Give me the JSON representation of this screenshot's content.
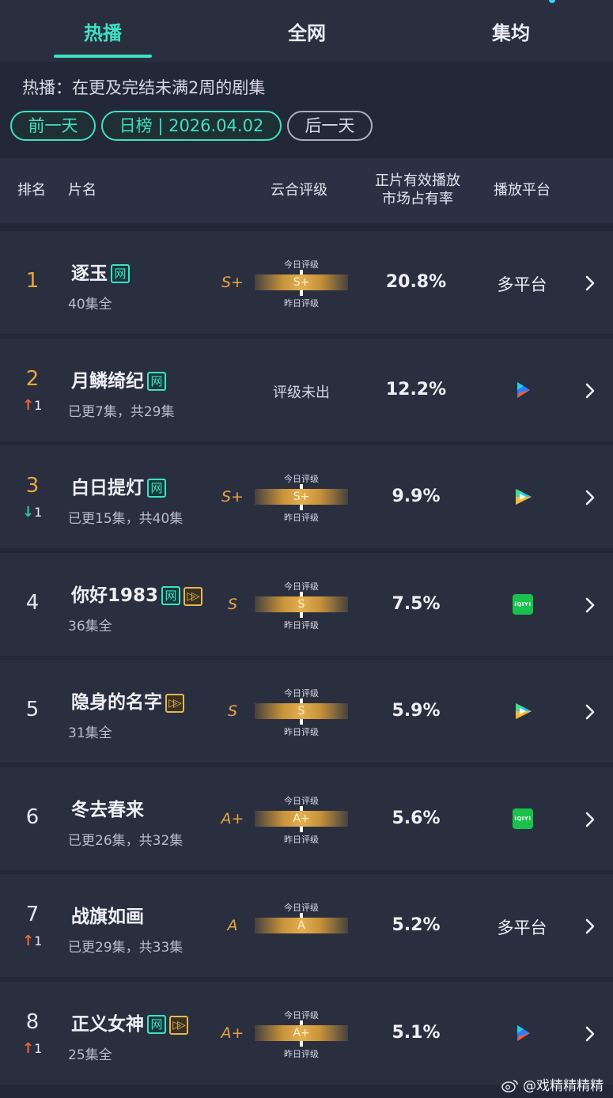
{
  "tabs": [
    {
      "label": "热播",
      "active": true
    },
    {
      "label": "全网",
      "active": false
    },
    {
      "label": "集均",
      "active": false
    }
  ],
  "subtitle": "热播：在更及完结未满2周的剧集",
  "nav": {
    "prev": "前一天",
    "current": "日榜 | 2026.04.02",
    "next": "后一天"
  },
  "table_header": {
    "rank": "排名",
    "name": "片名",
    "rating": "云合评级",
    "share_line1": "正片有效播放",
    "share_line2": "市场占有率",
    "platform": "播放平台"
  },
  "gauge_labels": {
    "today": "今日评级",
    "yesterday": "昨日评级"
  },
  "rows": [
    {
      "rank": "1",
      "change_dir": "",
      "change": "",
      "title": "逐玉",
      "badges": [
        "网"
      ],
      "episodes": "40集全",
      "grade": "S+",
      "gauge": "S+",
      "show_yesterday": true,
      "pending": "",
      "share": "20.8%",
      "platform_text": "多平台",
      "platform_icon": ""
    },
    {
      "rank": "2",
      "change_dir": "up",
      "change": "1",
      "title": "月鳞绮纪",
      "badges": [
        "网"
      ],
      "episodes": "已更7集，共29集",
      "grade": "",
      "gauge": "",
      "show_yesterday": false,
      "pending": "评级未出",
      "share": "12.2%",
      "platform_text": "",
      "platform_icon": "youku-icon"
    },
    {
      "rank": "3",
      "change_dir": "down",
      "change": "1",
      "title": "白日提灯",
      "badges": [
        "网"
      ],
      "episodes": "已更15集，共40集",
      "grade": "S+",
      "gauge": "S+",
      "show_yesterday": true,
      "pending": "",
      "share": "9.9%",
      "platform_text": "",
      "platform_icon": "tencent-video-icon"
    },
    {
      "rank": "4",
      "change_dir": "",
      "change": "",
      "title": "你好1983",
      "badges": [
        "网",
        "exclusive"
      ],
      "episodes": "36集全",
      "grade": "S",
      "gauge": "S",
      "show_yesterday": true,
      "pending": "",
      "share": "7.5%",
      "platform_text": "",
      "platform_icon": "iqiyi-icon"
    },
    {
      "rank": "5",
      "change_dir": "",
      "change": "",
      "title": "隐身的名字",
      "badges": [
        "exclusive"
      ],
      "episodes": "31集全",
      "grade": "S",
      "gauge": "S",
      "show_yesterday": true,
      "pending": "",
      "share": "5.9%",
      "platform_text": "",
      "platform_icon": "tencent-video-icon"
    },
    {
      "rank": "6",
      "change_dir": "",
      "change": "",
      "title": "冬去春来",
      "badges": [],
      "episodes": "已更26集，共32集",
      "grade": "A+",
      "gauge": "A+",
      "show_yesterday": true,
      "pending": "",
      "share": "5.6%",
      "platform_text": "",
      "platform_icon": "iqiyi-icon"
    },
    {
      "rank": "7",
      "change_dir": "up",
      "change": "1",
      "title": "战旗如画",
      "badges": [],
      "episodes": "已更29集，共33集",
      "grade": "A",
      "gauge": "A",
      "show_yesterday": false,
      "pending": "",
      "share": "5.2%",
      "platform_text": "多平台",
      "platform_icon": ""
    },
    {
      "rank": "8",
      "change_dir": "up",
      "change": "1",
      "title": "正义女神",
      "badges": [
        "网",
        "exclusive"
      ],
      "episodes": "25集全",
      "grade": "A+",
      "gauge": "A+",
      "show_yesterday": true,
      "pending": "",
      "share": "5.1%",
      "platform_text": "",
      "platform_icon": "youku-icon"
    }
  ],
  "iqiyi_text": "iQIYI",
  "watermark": "@戏精精精精",
  "colors": {
    "accent": "#3ee0c2",
    "rank_top": "#e8a640",
    "up": "#e8683a",
    "down": "#2fc79a",
    "background": "#232838",
    "row": "#2a2f40"
  }
}
